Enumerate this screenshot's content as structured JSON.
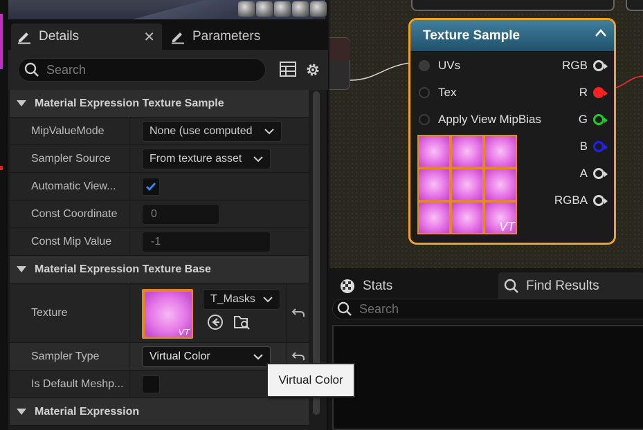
{
  "details": {
    "tabs": [
      {
        "label": "Details",
        "icon": "pencil-icon",
        "active": true
      },
      {
        "label": "Parameters",
        "icon": "pencil-icon",
        "active": false
      }
    ],
    "close_glyph": "✕",
    "search_placeholder": "Search",
    "sections": {
      "texture_sample": "Material Expression Texture Sample",
      "texture_base": "Material Expression Texture Base",
      "expression": "Material Expression"
    },
    "rows": {
      "mip_value_mode": {
        "label": "MipValueMode",
        "value": "None (use computed"
      },
      "sampler_source": {
        "label": "Sampler Source",
        "value": "From texture asset"
      },
      "automatic_view": {
        "label": "Automatic View...",
        "checked": true
      },
      "const_coordinate": {
        "label": "Const Coordinate",
        "value": "0"
      },
      "const_mip_value": {
        "label": "Const Mip Value",
        "value": "-1"
      },
      "texture": {
        "label": "Texture",
        "value": "T_Masks",
        "badge": "VT"
      },
      "sampler_type": {
        "label": "Sampler Type",
        "value": "Virtual Color"
      },
      "is_default_meshpaint": {
        "label": "Is Default Meshp...",
        "checked": false
      }
    }
  },
  "tooltip": {
    "text": "Virtual Color"
  },
  "node": {
    "title": "Texture Sample",
    "inputs": [
      "UVs",
      "Tex",
      "Apply View MipBias"
    ],
    "outputs": [
      {
        "label": "RGB",
        "color": "#d8d8d8"
      },
      {
        "label": "R",
        "color": "#ff2020"
      },
      {
        "label": "G",
        "color": "#20d020"
      },
      {
        "label": "B",
        "color": "#2020ff"
      },
      {
        "label": "A",
        "color": "#d8d8d8"
      },
      {
        "label": "RGBA",
        "color": "#d8d8d8"
      }
    ],
    "badge": "VT"
  },
  "bottom": {
    "tabs": [
      {
        "label": "Stats",
        "icon": "stats-icon"
      },
      {
        "label": "Find Results",
        "icon": "search-icon"
      }
    ],
    "search_placeholder": "Search"
  },
  "colors": {
    "accent_orange": "#f0a41e",
    "header_blue": "#2f6c89",
    "check_blue": "#2f8ef4"
  }
}
